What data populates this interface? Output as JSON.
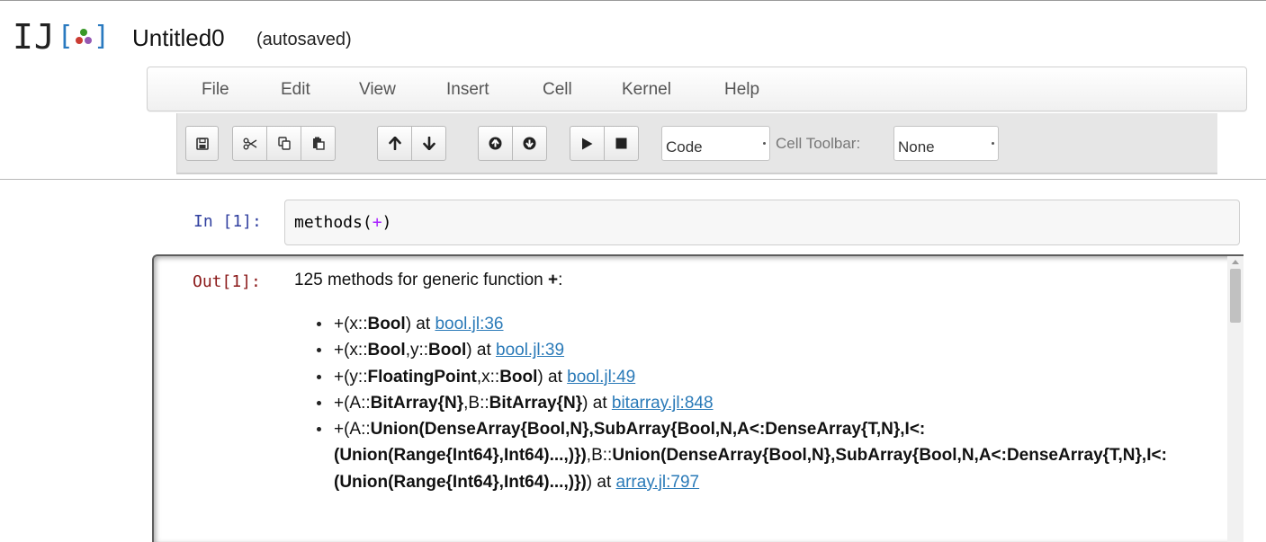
{
  "app": {
    "logo_text": "IJ",
    "notebook_name": "Untitled0",
    "autosave_status": "(autosaved)"
  },
  "menu": [
    "File",
    "Edit",
    "View",
    "Insert",
    "Cell",
    "Kernel",
    "Help"
  ],
  "toolbar": {
    "buttons": [
      "save-icon",
      "cut-icon",
      "copy-icon",
      "paste-icon",
      "arrow-up-icon",
      "arrow-down-icon",
      "insert-above-icon",
      "insert-below-icon",
      "run-icon",
      "stop-icon"
    ],
    "cell_type": "Code",
    "cell_toolbar_label": "Cell Toolbar:",
    "cell_toolbar_value": "None"
  },
  "input_cell": {
    "prompt": "In [1]:",
    "code_fn": "methods(",
    "code_op": "+",
    "code_close": ")"
  },
  "output_cell": {
    "prompt": "Out[1]:",
    "header_text": "125 methods for generic function ",
    "header_bold": "+",
    "header_end": ":",
    "methods": [
      {
        "sig": [
          "+(x::",
          "*Bool",
          ")"
        ],
        "link": "bool.jl:36"
      },
      {
        "sig": [
          "+(x::",
          "*Bool",
          ",y::",
          "*Bool",
          ")"
        ],
        "link": "bool.jl:39"
      },
      {
        "sig": [
          "+(y::",
          "*FloatingPoint",
          ",x::",
          "*Bool",
          ")"
        ],
        "link": "bool.jl:49"
      },
      {
        "sig": [
          "+(A::",
          "*BitArray{N}",
          ",B::",
          "*BitArray{N}",
          ")"
        ],
        "link": "bitarray.jl:848"
      },
      {
        "sig": [
          "+(A::",
          "*Union(DenseArray{Bool,N},SubArray{Bool,N,A<:DenseArray{T,N},I<:",
          "\n",
          "*(Union(Range{Int64},Int64)...,)})",
          ",B::",
          "*Union(DenseArray{Bool,N},SubArray{Bool,N,A<:DenseArray{T,N},I<:",
          "\n",
          "*(Union(Range{Int64},Int64)...,)})",
          ")"
        ],
        "link": "array.jl:797"
      }
    ],
    "link_prefix": " at "
  },
  "colors": {
    "in_prompt": "#303f9f",
    "out_prompt": "#8b1a1a",
    "link": "#2a7ab8",
    "logo_dots": [
      "#4063d8",
      "#389826",
      "#cb3c33",
      "#9558b2"
    ]
  }
}
